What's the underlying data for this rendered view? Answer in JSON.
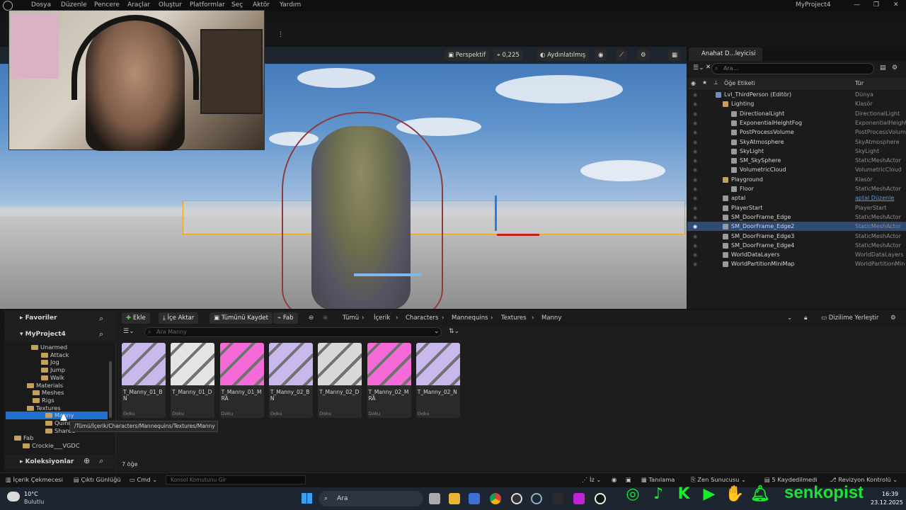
{
  "menu": {
    "items": [
      "Dosya",
      "Düzenle",
      "Pencere",
      "Araçlar",
      "Oluştur",
      "Platformlar",
      "Seç",
      "Aktör",
      "Yardım"
    ],
    "project": "MyProject4"
  },
  "viewport": {
    "perspective": "Perspektif",
    "speed": "0,225",
    "lit": "Aydınlatılmış"
  },
  "outliner": {
    "tab": "Anahat D...leyicisi",
    "search_placeholder": "Ara...",
    "col_label": "Öğe Etiketi",
    "col_type": "Tür",
    "rows": [
      {
        "name": "Lvl_ThirdPerson (Editör)",
        "type": "Dünya"
      },
      {
        "name": "Lighting",
        "type": "Klasör"
      },
      {
        "name": "DirectionalLight",
        "type": "DirectionalLight"
      },
      {
        "name": "ExponentialHeightFog",
        "type": "ExponentialHeight"
      },
      {
        "name": "PostProcessVolume",
        "type": "PostProcessVolum"
      },
      {
        "name": "SkyAtmosphere",
        "type": "SkyAtmosphere"
      },
      {
        "name": "SkyLight",
        "type": "SkyLight"
      },
      {
        "name": "SM_SkySphere",
        "type": "StaticMeshActor"
      },
      {
        "name": "VolumetricCloud",
        "type": "VolumetricCloud"
      },
      {
        "name": "Playground",
        "type": "Klasör"
      },
      {
        "name": "Floor",
        "type": "StaticMeshActor"
      },
      {
        "name": "aptal",
        "type": "aptal Düzenle"
      },
      {
        "name": "PlayerStart",
        "type": "PlayerStart"
      },
      {
        "name": "SM_DoorFrame_Edge",
        "type": "StaticMeshActor"
      },
      {
        "name": "SM_DoorFrame_Edge2",
        "type": "StaticMeshActor"
      },
      {
        "name": "SM_DoorFrame_Edge3",
        "type": "StaticMeshActor"
      },
      {
        "name": "SM_DoorFrame_Edge4",
        "type": "StaticMeshActor"
      },
      {
        "name": "WorldDataLayers",
        "type": "WorldDataLayers"
      },
      {
        "name": "WorldPartitionMiniMap",
        "type": "WorldPartitionMin"
      }
    ]
  },
  "content_browser": {
    "favorites": "Favoriler",
    "project": "MyProject4",
    "collections": "Koleksiyonlar",
    "tree": [
      "Unarmed",
      "Attack",
      "Jog",
      "Jump",
      "Walk",
      "Materials",
      "Meshes",
      "Rigs",
      "Textures",
      "Manny",
      "Quinn",
      "Shared",
      "Fab",
      "Crockie___VGDC"
    ],
    "buttons": {
      "add": "Ekle",
      "import": "İçe Aktar",
      "save_all": "Tümünü Kaydet",
      "fab": "Fab",
      "dock": "Dizilime Yerleştir"
    },
    "breadcrumb": [
      "Tümü",
      "İçerik",
      "Characters",
      "Mannequins",
      "Textures",
      "Manny"
    ],
    "search_placeholder": "Ara Manny",
    "items": [
      {
        "name": "T_Manny_01_BN",
        "type": "Doku",
        "color": "#c8b8ec"
      },
      {
        "name": "T_Manny_01_D",
        "type": "Doku",
        "color": "#e4e4e4"
      },
      {
        "name": "T_Manny_01_MRA",
        "type": "Doku",
        "color": "#f46ad6"
      },
      {
        "name": "T_Manny_02_BN",
        "type": "Doku",
        "color": "#c8b8ec"
      },
      {
        "name": "T_Manny_02_D",
        "type": "Doku",
        "color": "#d8d8d8"
      },
      {
        "name": "T_Manny_02_MRA",
        "type": "Doku",
        "color": "#f46ad6"
      },
      {
        "name": "T_Manny_02_N",
        "type": "Doku",
        "color": "#c8b8ec"
      }
    ],
    "count": "7 öğe",
    "tooltip": "/Tümü/İçerik/Characters/Mannequins/Textures/Manny"
  },
  "status": {
    "drawer": "İçerik Çekmecesi",
    "log": "Çıktı Günlüğü",
    "cmd": "Cmd",
    "console_placeholder": "Konsol Komutunu Gir",
    "trace": "İz",
    "derived": "Tanılama",
    "zen": "Zen Sunucusu",
    "saved": "5 Kaydedilmedi",
    "revision": "Revizyon Kontrolü"
  },
  "taskbar": {
    "temp": "10°C",
    "weather": "Bulutlu",
    "search": "Ara",
    "time": "16:39",
    "date": "23.12.2025"
  },
  "overlay": {
    "brand": "senkopist"
  }
}
